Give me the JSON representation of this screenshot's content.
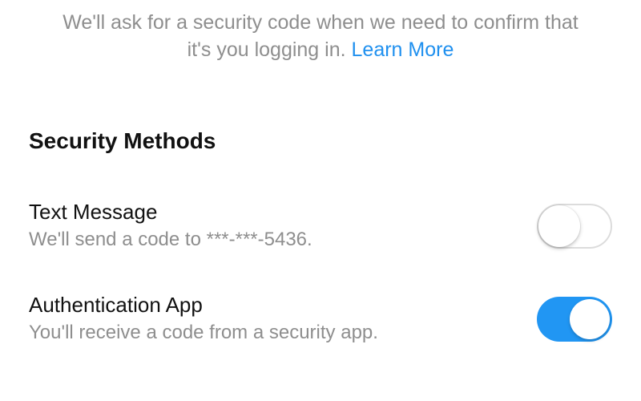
{
  "intro": {
    "text": "We'll ask for a security code when we need to confirm that it's you logging in. ",
    "learn_more": "Learn More"
  },
  "section_heading": "Security Methods",
  "methods": {
    "text_message": {
      "title": "Text Message",
      "desc": "We'll send a code to ***-***-5436.",
      "enabled": false
    },
    "auth_app": {
      "title": "Authentication App",
      "desc": "You'll receive a code from a security app.",
      "enabled": true
    }
  },
  "colors": {
    "accent": "#2196f3",
    "link": "#1f90ef",
    "muted": "#8e8e8e"
  }
}
